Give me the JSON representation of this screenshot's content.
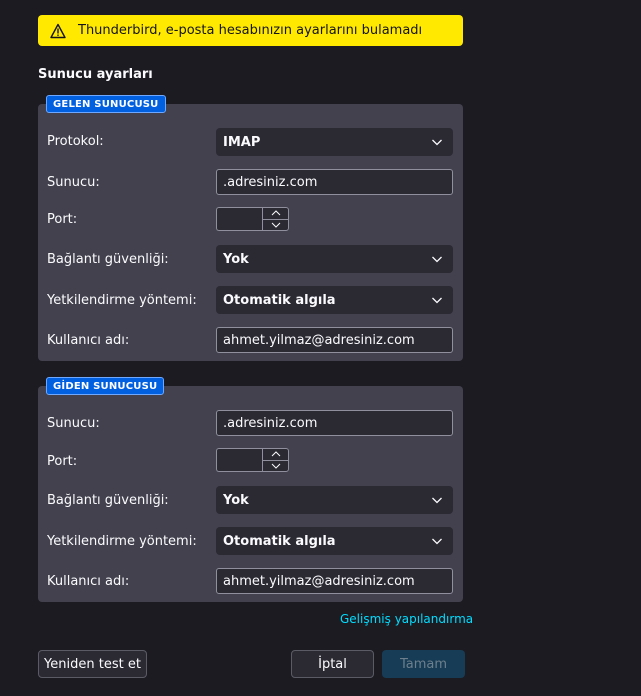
{
  "warning": {
    "text": "Thunderbird, e-posta hesabınızın ayarlarını bulamadı"
  },
  "section_title": "Sunucu ayarları",
  "incoming": {
    "badge": "GELEN SUNUCUSU",
    "protocol_label": "Protokol:",
    "protocol_value": "IMAP",
    "server_label": "Sunucu:",
    "server_value": ".adresiniz.com",
    "port_label": "Port:",
    "port_value": "",
    "security_label": "Bağlantı güvenliği:",
    "security_value": "Yok",
    "auth_label": "Yetkilendirme yöntemi:",
    "auth_value": "Otomatik algıla",
    "username_label": "Kullanıcı adı:",
    "username_value": "ahmet.yilmaz@adresiniz.com"
  },
  "outgoing": {
    "badge": "GİDEN SUNUCUSU",
    "server_label": "Sunucu:",
    "server_value": ".adresiniz.com",
    "port_label": "Port:",
    "port_value": "",
    "security_label": "Bağlantı güvenliği:",
    "security_value": "Yok",
    "auth_label": "Yetkilendirme yöntemi:",
    "auth_value": "Otomatik algıla",
    "username_label": "Kullanıcı adı:",
    "username_value": "ahmet.yilmaz@adresiniz.com"
  },
  "advanced_link": "Gelişmiş yapılandırma",
  "buttons": {
    "retest": "Yeniden test et",
    "cancel": "İptal",
    "done": "Tamam"
  },
  "colors": {
    "warning_bg": "#ffe900",
    "panel_bg": "#42414d",
    "badge_bg": "#0060df",
    "link": "#00ddff"
  }
}
